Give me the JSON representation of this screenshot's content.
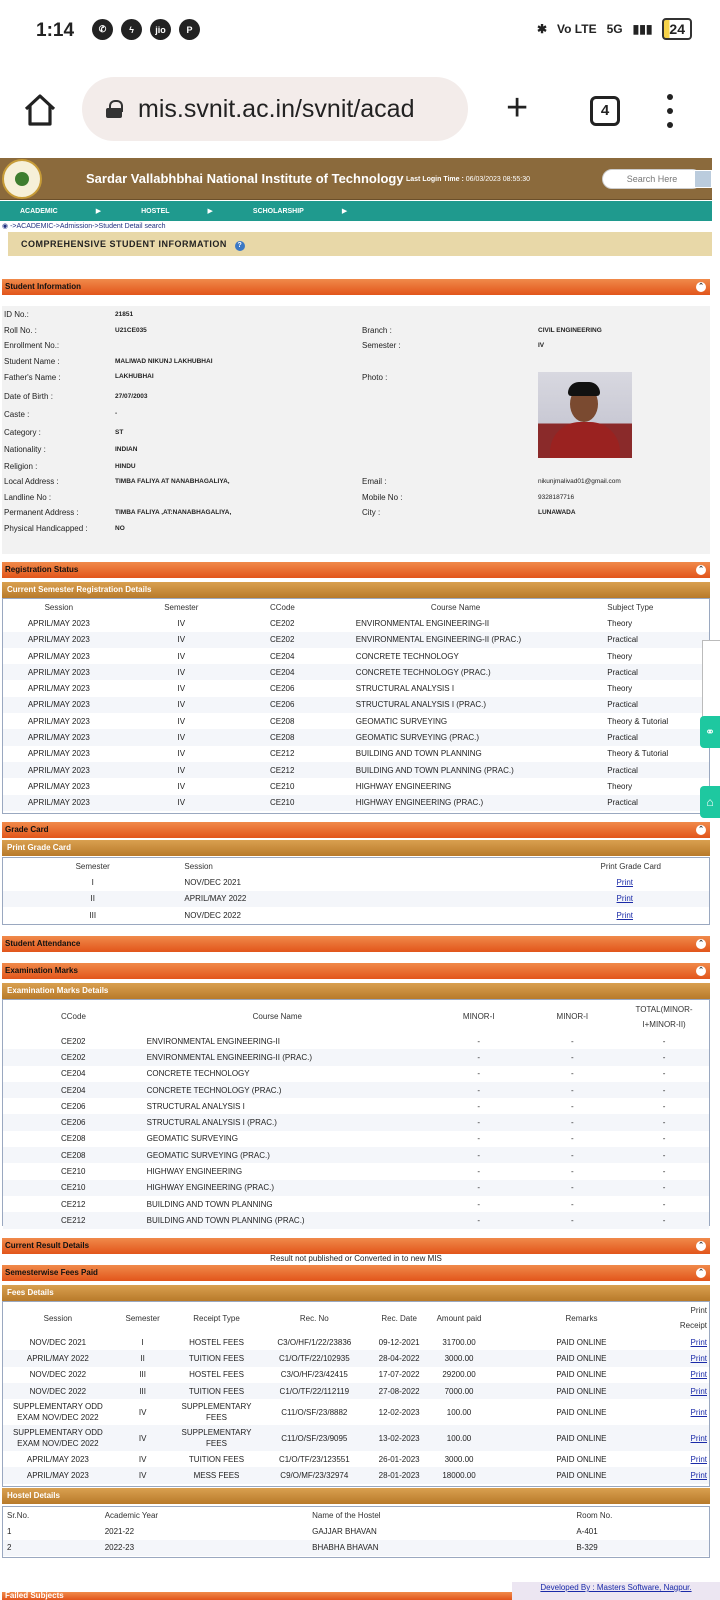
{
  "status_bar": {
    "time": "1:14",
    "network": "5G",
    "volte": "Vo LTE",
    "battery": "24",
    "app_icons": [
      "whatsapp-icon",
      "messenger-icon",
      "jio-icon",
      "pinterest-icon"
    ]
  },
  "browser": {
    "url": "mis.svnit.ac.in/svnit/acad",
    "tab_count": "4"
  },
  "site": {
    "title": "Sardar Vallabhbhai National Institute of Technology",
    "last_login_label": "Last Login Time :",
    "last_login_value": "06/03/2023 08:55:30",
    "search_placeholder": "Search Here",
    "menu": [
      "ACADEMIC",
      "HOSTEL",
      "SCHOLARSHIP"
    ],
    "breadcrumb": "->ACADEMIC->Admission->Student Detail search",
    "page_heading": "COMPREHENSIVE STUDENT INFORMATION"
  },
  "student_info": {
    "section_title": "Student Information",
    "id_no": {
      "label": "ID No.:",
      "value": "21851"
    },
    "roll_no": {
      "label": "Roll No. :",
      "value": "U21CE035"
    },
    "branch": {
      "label": "Branch :",
      "value": "CIVIL ENGINEERING"
    },
    "enrollment_no": {
      "label": "Enrollment No.:",
      "value": ""
    },
    "semester": {
      "label": "Semester :",
      "value": "IV"
    },
    "student_name": {
      "label": "Student Name :",
      "value": "MALIWAD NIKUNJ LAKHUBHAI"
    },
    "father_name": {
      "label": "Father's Name :",
      "value": "LAKHUBHAI"
    },
    "photo": {
      "label": "Photo :"
    },
    "dob": {
      "label": "Date of Birth :",
      "value": "27/07/2003"
    },
    "caste": {
      "label": "Caste :",
      "value": "-"
    },
    "category": {
      "label": "Category :",
      "value": "ST"
    },
    "nationality": {
      "label": "Nationality :",
      "value": "INDIAN"
    },
    "religion": {
      "label": "Religion :",
      "value": "HINDU"
    },
    "local_address": {
      "label": "Local Address :",
      "value": "TIMBA FALIYA AT NANABHAGALIYA,"
    },
    "email": {
      "label": "Email :",
      "value": "nikunjmalivad01@gmail.com"
    },
    "landline": {
      "label": "Landline No :",
      "value": ""
    },
    "mobile": {
      "label": "Mobile No :",
      "value": "9328187716"
    },
    "permanent_address": {
      "label": "Permanent Address :",
      "value": "TIMBA FALIYA ,AT:NANABHAGALIYA,"
    },
    "city": {
      "label": "City :",
      "value": "LUNAWADA"
    },
    "physical_handicapped": {
      "label": "Physical Handicapped :",
      "value": "NO"
    }
  },
  "registration": {
    "section_title": "Registration Status",
    "sub_title": "Current Semester Registration Details",
    "headers": [
      "Session",
      "Semester",
      "CCode",
      "Course Name",
      "Subject Type"
    ],
    "rows": [
      [
        "APRIL/MAY 2023",
        "IV",
        "CE202",
        "ENVIRONMENTAL ENGINEERING-II",
        "Theory"
      ],
      [
        "APRIL/MAY 2023",
        "IV",
        "CE202",
        "ENVIRONMENTAL ENGINEERING-II (PRAC.)",
        "Practical"
      ],
      [
        "APRIL/MAY 2023",
        "IV",
        "CE204",
        "CONCRETE TECHNOLOGY",
        "Theory"
      ],
      [
        "APRIL/MAY 2023",
        "IV",
        "CE204",
        "CONCRETE TECHNOLOGY (PRAC.)",
        "Practical"
      ],
      [
        "APRIL/MAY 2023",
        "IV",
        "CE206",
        "STRUCTURAL ANALYSIS I",
        "Theory"
      ],
      [
        "APRIL/MAY 2023",
        "IV",
        "CE206",
        "STRUCTURAL ANALYSIS I (PRAC.)",
        "Practical"
      ],
      [
        "APRIL/MAY 2023",
        "IV",
        "CE208",
        "GEOMATIC SURVEYING",
        "Theory & Tutorial"
      ],
      [
        "APRIL/MAY 2023",
        "IV",
        "CE208",
        "GEOMATIC SURVEYING (PRAC.)",
        "Practical"
      ],
      [
        "APRIL/MAY 2023",
        "IV",
        "CE212",
        "BUILDING AND TOWN PLANNING",
        "Theory & Tutorial"
      ],
      [
        "APRIL/MAY 2023",
        "IV",
        "CE212",
        "BUILDING AND TOWN PLANNING (PRAC.)",
        "Practical"
      ],
      [
        "APRIL/MAY 2023",
        "IV",
        "CE210",
        "HIGHWAY ENGINEERING",
        "Theory"
      ],
      [
        "APRIL/MAY 2023",
        "IV",
        "CE210",
        "HIGHWAY ENGINEERING (PRAC.)",
        "Practical"
      ]
    ]
  },
  "grade_card": {
    "section_title": "Grade Card",
    "sub_title": "Print Grade Card",
    "headers": [
      "Semester",
      "Session",
      "Print Grade Card"
    ],
    "rows": [
      [
        "I",
        "NOV/DEC 2021",
        "Print"
      ],
      [
        "II",
        "APRIL/MAY 2022",
        "Print"
      ],
      [
        "III",
        "NOV/DEC 2022",
        "Print"
      ]
    ]
  },
  "attendance": {
    "section_title": "Student Attendance"
  },
  "exam_marks": {
    "section_title": "Examination Marks",
    "sub_title": "Examination Marks Details",
    "headers": [
      "CCode",
      "Course Name",
      "MINOR-I",
      "MINOR-I",
      "TOTAL(MINOR-I+MINOR-II)"
    ],
    "rows": [
      [
        "CE202",
        "ENVIRONMENTAL ENGINEERING-II",
        "-",
        "-",
        "-"
      ],
      [
        "CE202",
        "ENVIRONMENTAL ENGINEERING-II (PRAC.)",
        "-",
        "-",
        "-"
      ],
      [
        "CE204",
        "CONCRETE TECHNOLOGY",
        "-",
        "-",
        "-"
      ],
      [
        "CE204",
        "CONCRETE TECHNOLOGY (PRAC.)",
        "-",
        "-",
        "-"
      ],
      [
        "CE206",
        "STRUCTURAL ANALYSIS I",
        "-",
        "-",
        "-"
      ],
      [
        "CE206",
        "STRUCTURAL ANALYSIS I (PRAC.)",
        "-",
        "-",
        "-"
      ],
      [
        "CE208",
        "GEOMATIC SURVEYING",
        "-",
        "-",
        "-"
      ],
      [
        "CE208",
        "GEOMATIC SURVEYING (PRAC.)",
        "-",
        "-",
        "-"
      ],
      [
        "CE210",
        "HIGHWAY ENGINEERING",
        "-",
        "-",
        "-"
      ],
      [
        "CE210",
        "HIGHWAY ENGINEERING (PRAC.)",
        "-",
        "-",
        "-"
      ],
      [
        "CE212",
        "BUILDING AND TOWN PLANNING",
        "-",
        "-",
        "-"
      ],
      [
        "CE212",
        "BUILDING AND TOWN PLANNING (PRAC.)",
        "-",
        "-",
        "-"
      ]
    ]
  },
  "current_result": {
    "section_title": "Current Result Details",
    "message": "Result not published or Converted in to new MIS"
  },
  "fees": {
    "section_title": "Semesterwise Fees Paid",
    "sub_title": "Fees Details",
    "headers": [
      "Session",
      "Semester",
      "Receipt Type",
      "Rec. No",
      "Rec. Date",
      "Amount paid",
      "Remarks",
      "Print Receipt"
    ],
    "rows": [
      [
        "NOV/DEC 2021",
        "I",
        "HOSTEL FEES",
        "C3/O/HF/1/22/23836",
        "09-12-2021",
        "31700.00",
        "PAID ONLINE",
        "Print"
      ],
      [
        "APRIL/MAY 2022",
        "II",
        "TUITION FEES",
        "C1/O/TF/22/102935",
        "28-04-2022",
        "3000.00",
        "PAID ONLINE",
        "Print"
      ],
      [
        "NOV/DEC 2022",
        "III",
        "HOSTEL FEES",
        "C3/O/HF/23/42415",
        "17-07-2022",
        "29200.00",
        "PAID ONLINE",
        "Print"
      ],
      [
        "NOV/DEC 2022",
        "III",
        "TUITION FEES",
        "C1/O/TF/22/112119",
        "27-08-2022",
        "7000.00",
        "PAID ONLINE",
        "Print"
      ],
      [
        "SUPPLEMENTARY ODD EXAM NOV/DEC 2022",
        "IV",
        "SUPPLEMENTARY FEES",
        "C11/O/SF/23/8882",
        "12-02-2023",
        "100.00",
        "PAID ONLINE",
        "Print"
      ],
      [
        "SUPPLEMENTARY ODD EXAM NOV/DEC 2022",
        "IV",
        "SUPPLEMENTARY FEES",
        "C11/O/SF/23/9095",
        "13-02-2023",
        "100.00",
        "PAID ONLINE",
        "Print"
      ],
      [
        "APRIL/MAY 2023",
        "IV",
        "TUITION FEES",
        "C1/O/TF/23/123551",
        "26-01-2023",
        "3000.00",
        "PAID ONLINE",
        "Print"
      ],
      [
        "APRIL/MAY 2023",
        "IV",
        "MESS FEES",
        "C9/O/MF/23/32974",
        "28-01-2023",
        "18000.00",
        "PAID ONLINE",
        "Print"
      ]
    ]
  },
  "hostel": {
    "sub_title": "Hostel Details",
    "headers": [
      "Sr.No.",
      "Academic Year",
      "Name of the Hostel",
      "Room No."
    ],
    "rows": [
      [
        "1",
        "2021-22",
        "GAJJAR BHAVAN",
        "A-401"
      ],
      [
        "2",
        "2022-23",
        "BHABHA BHAVAN",
        "B-329"
      ]
    ]
  },
  "failed_subjects": {
    "section_title": "Failed Subjects"
  },
  "footer": {
    "developer": "Developed By : Masters Software, Nagpur."
  },
  "colors": {
    "banner": "#8b6a3c",
    "menu": "#1f9a8e",
    "section": "#e2551b",
    "subsection": "#b87a2a",
    "link": "#1a2aa8",
    "float_button": "#1ec8a0"
  }
}
